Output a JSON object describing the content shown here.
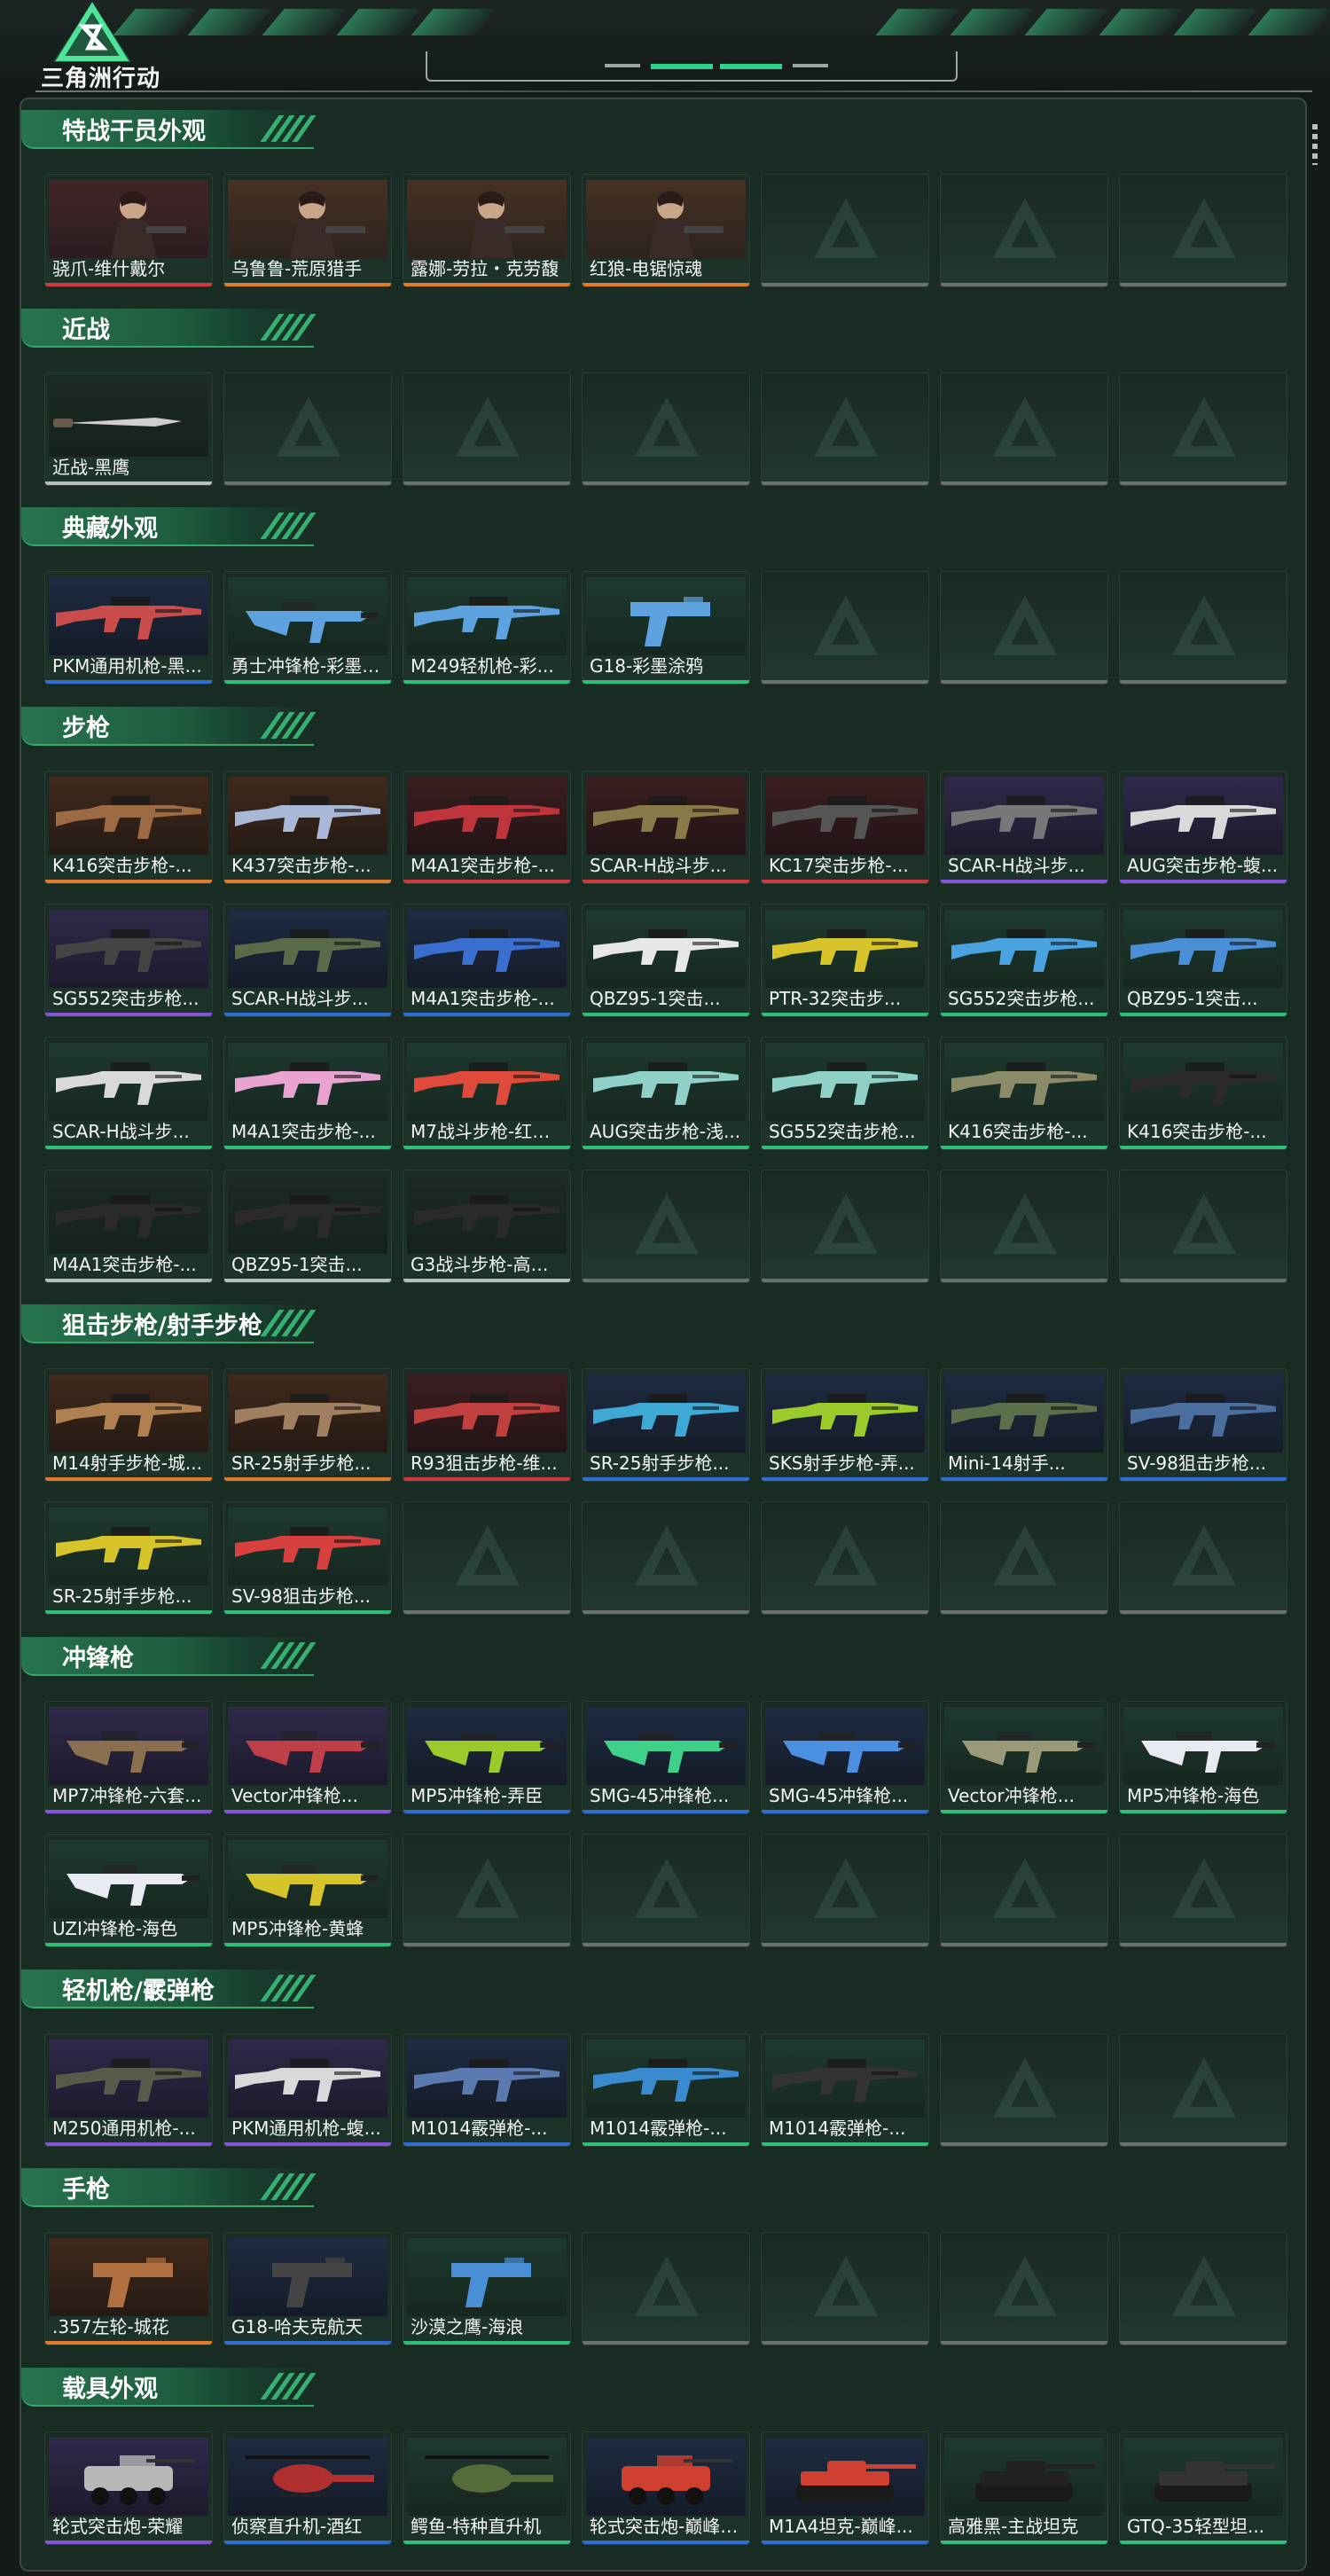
{
  "app": {
    "brand": "三角洲行动"
  },
  "colors": {
    "accent": "#2fd08c",
    "orange": "#e07b2b",
    "red": "#d13a3d",
    "purple": "#8753d8",
    "blue": "#2f6fd4",
    "green": "#2fbf78",
    "white": "#b6bdba"
  },
  "sections": [
    {
      "title": "特战干员外观",
      "items": [
        {
          "label": "骁爪-维什戴尔",
          "q": "red",
          "kind": "person"
        },
        {
          "label": "乌鲁鲁-荒原猎手",
          "q": "orange",
          "kind": "person"
        },
        {
          "label": "露娜-劳拉・克劳馥",
          "q": "orange",
          "kind": "person"
        },
        {
          "label": "红狼-电锯惊魂",
          "q": "orange",
          "kind": "person"
        }
      ]
    },
    {
      "title": "近战",
      "items": [
        {
          "label": "近战-黑鹰",
          "q": "white",
          "kind": "knife"
        }
      ]
    },
    {
      "title": "典藏外观",
      "items": [
        {
          "label": "PKM通用机枪-黑...",
          "q": "blue",
          "kind": "gun",
          "color": "#c94d4d"
        },
        {
          "label": "勇士冲锋枪-彩墨涂...",
          "q": "green",
          "kind": "smg",
          "color": "#5ea3e0"
        },
        {
          "label": "M249轻机枪-彩...",
          "q": "green",
          "kind": "gun",
          "color": "#5ea3e0"
        },
        {
          "label": "G18-彩墨涂鸦",
          "q": "green",
          "kind": "pistol",
          "color": "#5ea3e0"
        }
      ]
    },
    {
      "title": "步枪",
      "items": [
        {
          "label": "K416突击步枪-...",
          "q": "orange",
          "kind": "gun",
          "color": "#9c6a43"
        },
        {
          "label": "K437突击步枪-...",
          "q": "orange",
          "kind": "gun",
          "color": "#a9b8d6"
        },
        {
          "label": "M4A1突击步枪-...",
          "q": "red",
          "kind": "gun",
          "color": "#c0353b"
        },
        {
          "label": "SCAR-H战斗步...",
          "q": "red",
          "kind": "gun",
          "color": "#8a7a4a"
        },
        {
          "label": "KC17突击步枪-...",
          "q": "red",
          "kind": "gun",
          "color": "#555555"
        },
        {
          "label": "SCAR-H战斗步...",
          "q": "purple",
          "kind": "gun",
          "color": "#777777"
        },
        {
          "label": "AUG突击步枪-蝮...",
          "q": "purple",
          "kind": "gun",
          "color": "#d9d9d9"
        },
        {
          "label": "SG552突击步枪...",
          "q": "purple",
          "kind": "gun",
          "color": "#444444"
        },
        {
          "label": "SCAR-H战斗步...",
          "q": "blue",
          "kind": "gun",
          "color": "#5b6b4a"
        },
        {
          "label": "M4A1突击步枪-...",
          "q": "blue",
          "kind": "gun",
          "color": "#3a6fd0"
        },
        {
          "label": "QBZ95-1突击...",
          "q": "green",
          "kind": "gun",
          "color": "#e7e7e7"
        },
        {
          "label": "PTR-32突击步...",
          "q": "green",
          "kind": "gun",
          "color": "#d6c42a"
        },
        {
          "label": "SG552突击步枪...",
          "q": "green",
          "kind": "gun",
          "color": "#4aa3e0"
        },
        {
          "label": "QBZ95-1突击...",
          "q": "green",
          "kind": "gun",
          "color": "#4a8fd6"
        },
        {
          "label": "SCAR-H战斗步...",
          "q": "green",
          "kind": "gun",
          "color": "#d9d9d9"
        },
        {
          "label": "M4A1突击步枪-...",
          "q": "green",
          "kind": "gun",
          "color": "#e8a3d0"
        },
        {
          "label": "M7战斗步枪-红色...",
          "q": "green",
          "kind": "gun",
          "color": "#e04a3a"
        },
        {
          "label": "AUG突击步枪-浅...",
          "q": "green",
          "kind": "gun",
          "color": "#8fd1c6"
        },
        {
          "label": "SG552突击步枪...",
          "q": "green",
          "kind": "gun",
          "color": "#8fd1c6"
        },
        {
          "label": "K416突击步枪-...",
          "q": "green",
          "kind": "gun",
          "color": "#8b8b6a"
        },
        {
          "label": "K416突击步枪-...",
          "q": "green",
          "kind": "gun",
          "color": "#2a2a2a"
        },
        {
          "label": "M4A1突击步枪-...",
          "q": "white",
          "kind": "gun",
          "color": "#2a2a2a"
        },
        {
          "label": "QBZ95-1突击...",
          "q": "white",
          "kind": "gun",
          "color": "#2a2a2a"
        },
        {
          "label": "G3战斗步枪-高雅...",
          "q": "white",
          "kind": "gun",
          "color": "#2a2a2a"
        }
      ]
    },
    {
      "title": "狙击步枪/射手步枪",
      "items": [
        {
          "label": "M14射手步枪-城...",
          "q": "orange",
          "kind": "gun",
          "color": "#b08050"
        },
        {
          "label": "SR-25射手步枪...",
          "q": "orange",
          "kind": "gun",
          "color": "#a08060"
        },
        {
          "label": "R93狙击步枪-维...",
          "q": "red",
          "kind": "gun",
          "color": "#c04040"
        },
        {
          "label": "SR-25射手步枪...",
          "q": "blue",
          "kind": "gun",
          "color": "#3fa9d6"
        },
        {
          "label": "SKS射手步枪-弄...",
          "q": "blue",
          "kind": "gun",
          "color": "#9acb2a"
        },
        {
          "label": "Mini-14射手...",
          "q": "blue",
          "kind": "gun",
          "color": "#5a6f4a"
        },
        {
          "label": "SV-98狙击步枪...",
          "q": "blue",
          "kind": "gun",
          "color": "#4a6f9f"
        },
        {
          "label": "SR-25射手步枪...",
          "q": "green",
          "kind": "gun",
          "color": "#d6c42a"
        },
        {
          "label": "SV-98狙击步枪...",
          "q": "green",
          "kind": "gun",
          "color": "#d84040"
        }
      ]
    },
    {
      "title": "冲锋枪",
      "items": [
        {
          "label": "MP7冲锋枪-六套...",
          "q": "purple",
          "kind": "smg",
          "color": "#8a7050"
        },
        {
          "label": "Vector冲锋枪...",
          "q": "purple",
          "kind": "smg",
          "color": "#c0404a"
        },
        {
          "label": "MP5冲锋枪-弄臣",
          "q": "blue",
          "kind": "smg",
          "color": "#9acb2a"
        },
        {
          "label": "SMG-45冲锋枪...",
          "q": "blue",
          "kind": "smg",
          "color": "#3fd08a"
        },
        {
          "label": "SMG-45冲锋枪...",
          "q": "blue",
          "kind": "smg",
          "color": "#4a8fe0"
        },
        {
          "label": "Vector冲锋枪...",
          "q": "green",
          "kind": "smg",
          "color": "#9a9a7a"
        },
        {
          "label": "MP5冲锋枪-海色",
          "q": "green",
          "kind": "smg",
          "color": "#e8ecf2"
        },
        {
          "label": "UZI冲锋枪-海色",
          "q": "green",
          "kind": "smg",
          "color": "#e8ecf2"
        },
        {
          "label": "MP5冲锋枪-黄蜂",
          "q": "green",
          "kind": "smg",
          "color": "#d6c42a"
        }
      ]
    },
    {
      "title": "轻机枪/霰弹枪",
      "items": [
        {
          "label": "M250通用机枪-...",
          "q": "purple",
          "kind": "gun",
          "color": "#5a5a4a"
        },
        {
          "label": "PKM通用机枪-蝮...",
          "q": "purple",
          "kind": "gun",
          "color": "#d9d9d9"
        },
        {
          "label": "M1014霰弹枪-...",
          "q": "blue",
          "kind": "gun",
          "color": "#5a7ab0"
        },
        {
          "label": "M1014霰弹枪-...",
          "q": "green",
          "kind": "gun",
          "color": "#3a8ad0"
        },
        {
          "label": "M1014霰弹枪-...",
          "q": "green",
          "kind": "gun",
          "color": "#333333"
        }
      ]
    },
    {
      "title": "手枪",
      "items": [
        {
          "label": ".357左轮-城花",
          "q": "orange",
          "kind": "pistol",
          "color": "#b07040"
        },
        {
          "label": "G18-哈夫克航天",
          "q": "blue",
          "kind": "pistol",
          "color": "#444444"
        },
        {
          "label": "沙漠之鹰-海浪",
          "q": "green",
          "kind": "pistol",
          "color": "#4a8fd6"
        }
      ]
    },
    {
      "title": "载具外观",
      "items": [
        {
          "label": "轮式突击炮-荣耀",
          "q": "purple",
          "kind": "vehicle",
          "color": "#b8b8b8"
        },
        {
          "label": "侦察直升机-酒红",
          "q": "blue",
          "kind": "heli",
          "color": "#b03030"
        },
        {
          "label": "鳄鱼-特种直升机",
          "q": "green",
          "kind": "heli",
          "color": "#556b3a"
        },
        {
          "label": "轮式突击炮-巅峰竞...",
          "q": "blue",
          "kind": "vehicle",
          "color": "#d04030"
        },
        {
          "label": "M1A4坦克-巅峰...",
          "q": "blue",
          "kind": "tank",
          "color": "#d04030"
        },
        {
          "label": "高雅黑-主战坦克",
          "q": "green",
          "kind": "tank",
          "color": "#222222"
        },
        {
          "label": "GTQ-35轻型坦...",
          "q": "green",
          "kind": "tank",
          "color": "#333333"
        }
      ]
    }
  ]
}
